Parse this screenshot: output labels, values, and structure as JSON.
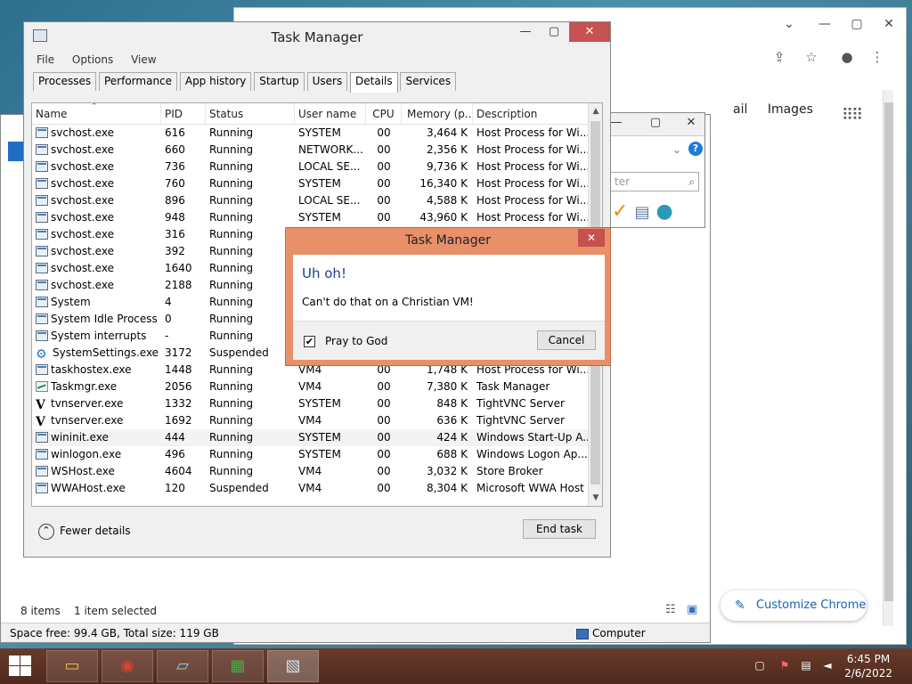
{
  "chrome": {
    "links": [
      "ail",
      "Images"
    ],
    "customize": "Customize Chrome"
  },
  "explorer": {
    "items": "8 items",
    "selected": "1 item selected",
    "space": "Space free: 99.4 GB, Total size: 119 GB",
    "computer": "Computer"
  },
  "midwin": {
    "field": "ter"
  },
  "tm": {
    "title": "Task Manager",
    "menu": [
      "File",
      "Options",
      "View"
    ],
    "tabs": [
      "Processes",
      "Performance",
      "App history",
      "Startup",
      "Users",
      "Details",
      "Services"
    ],
    "columns": [
      "Name",
      "PID",
      "Status",
      "User name",
      "CPU",
      "Memory (p...",
      "Description"
    ],
    "rows": [
      {
        "name": "svchost.exe",
        "pid": "616",
        "status": "Running",
        "user": "SYSTEM",
        "cpu": "00",
        "mem": "3,464 K",
        "desc": "Host Process for Wi...",
        "icon": "app"
      },
      {
        "name": "svchost.exe",
        "pid": "660",
        "status": "Running",
        "user": "NETWORK...",
        "cpu": "00",
        "mem": "2,356 K",
        "desc": "Host Process for Wi...",
        "icon": "app"
      },
      {
        "name": "svchost.exe",
        "pid": "736",
        "status": "Running",
        "user": "LOCAL SE...",
        "cpu": "00",
        "mem": "9,736 K",
        "desc": "Host Process for Wi...",
        "icon": "app"
      },
      {
        "name": "svchost.exe",
        "pid": "760",
        "status": "Running",
        "user": "SYSTEM",
        "cpu": "00",
        "mem": "16,340 K",
        "desc": "Host Process for Wi...",
        "icon": "app"
      },
      {
        "name": "svchost.exe",
        "pid": "896",
        "status": "Running",
        "user": "LOCAL SE...",
        "cpu": "00",
        "mem": "4,588 K",
        "desc": "Host Process for Wi...",
        "icon": "app"
      },
      {
        "name": "svchost.exe",
        "pid": "948",
        "status": "Running",
        "user": "SYSTEM",
        "cpu": "00",
        "mem": "43,960 K",
        "desc": "Host Process for Wi...",
        "icon": "app"
      },
      {
        "name": "svchost.exe",
        "pid": "316",
        "status": "Running",
        "user": "",
        "cpu": "",
        "mem": "",
        "desc": "",
        "icon": "app"
      },
      {
        "name": "svchost.exe",
        "pid": "392",
        "status": "Running",
        "user": "",
        "cpu": "",
        "mem": "",
        "desc": "",
        "icon": "app"
      },
      {
        "name": "svchost.exe",
        "pid": "1640",
        "status": "Running",
        "user": "",
        "cpu": "",
        "mem": "",
        "desc": "",
        "icon": "app"
      },
      {
        "name": "svchost.exe",
        "pid": "2188",
        "status": "Running",
        "user": "",
        "cpu": "",
        "mem": "",
        "desc": "",
        "icon": "app"
      },
      {
        "name": "System",
        "pid": "4",
        "status": "Running",
        "user": "",
        "cpu": "",
        "mem": "",
        "desc": "",
        "icon": "app"
      },
      {
        "name": "System Idle Process",
        "pid": "0",
        "status": "Running",
        "user": "",
        "cpu": "",
        "mem": "",
        "desc": "",
        "icon": "app"
      },
      {
        "name": "System interrupts",
        "pid": "-",
        "status": "Running",
        "user": "",
        "cpu": "",
        "mem": "",
        "desc": "",
        "icon": "app"
      },
      {
        "name": "SystemSettings.exe",
        "pid": "3172",
        "status": "Suspended",
        "user": "",
        "cpu": "",
        "mem": "",
        "desc": "",
        "icon": "gear"
      },
      {
        "name": "taskhostex.exe",
        "pid": "1448",
        "status": "Running",
        "user": "VM4",
        "cpu": "00",
        "mem": "1,748 K",
        "desc": "Host Process for Wi...",
        "icon": "app"
      },
      {
        "name": "Taskmgr.exe",
        "pid": "2056",
        "status": "Running",
        "user": "VM4",
        "cpu": "00",
        "mem": "7,380 K",
        "desc": "Task Manager",
        "icon": "tm"
      },
      {
        "name": "tvnserver.exe",
        "pid": "1332",
        "status": "Running",
        "user": "SYSTEM",
        "cpu": "00",
        "mem": "848 K",
        "desc": "TightVNC Server",
        "icon": "vnc"
      },
      {
        "name": "tvnserver.exe",
        "pid": "1692",
        "status": "Running",
        "user": "VM4",
        "cpu": "00",
        "mem": "636 K",
        "desc": "TightVNC Server",
        "icon": "vnc"
      },
      {
        "name": "wininit.exe",
        "pid": "444",
        "status": "Running",
        "user": "SYSTEM",
        "cpu": "00",
        "mem": "424 K",
        "desc": "Windows Start-Up A...",
        "icon": "app",
        "selected": true
      },
      {
        "name": "winlogon.exe",
        "pid": "496",
        "status": "Running",
        "user": "SYSTEM",
        "cpu": "00",
        "mem": "688 K",
        "desc": "Windows Logon Ap...",
        "icon": "app"
      },
      {
        "name": "WSHost.exe",
        "pid": "4604",
        "status": "Running",
        "user": "VM4",
        "cpu": "00",
        "mem": "3,032 K",
        "desc": "Store Broker",
        "icon": "app"
      },
      {
        "name": "WWAHost.exe",
        "pid": "120",
        "status": "Suspended",
        "user": "VM4",
        "cpu": "00",
        "mem": "8,304 K",
        "desc": "Microsoft WWA Host",
        "icon": "app"
      }
    ],
    "fewer_details": "Fewer details",
    "end_task": "End task"
  },
  "dialog": {
    "title": "Task Manager",
    "heading": "Uh oh!",
    "message": "Can't do that on a Christian VM!",
    "checkbox_label": "Pray to God",
    "checkbox_checked": true,
    "cancel": "Cancel"
  },
  "taskbar": {
    "time": "6:45 PM",
    "date": "2/6/2022"
  }
}
